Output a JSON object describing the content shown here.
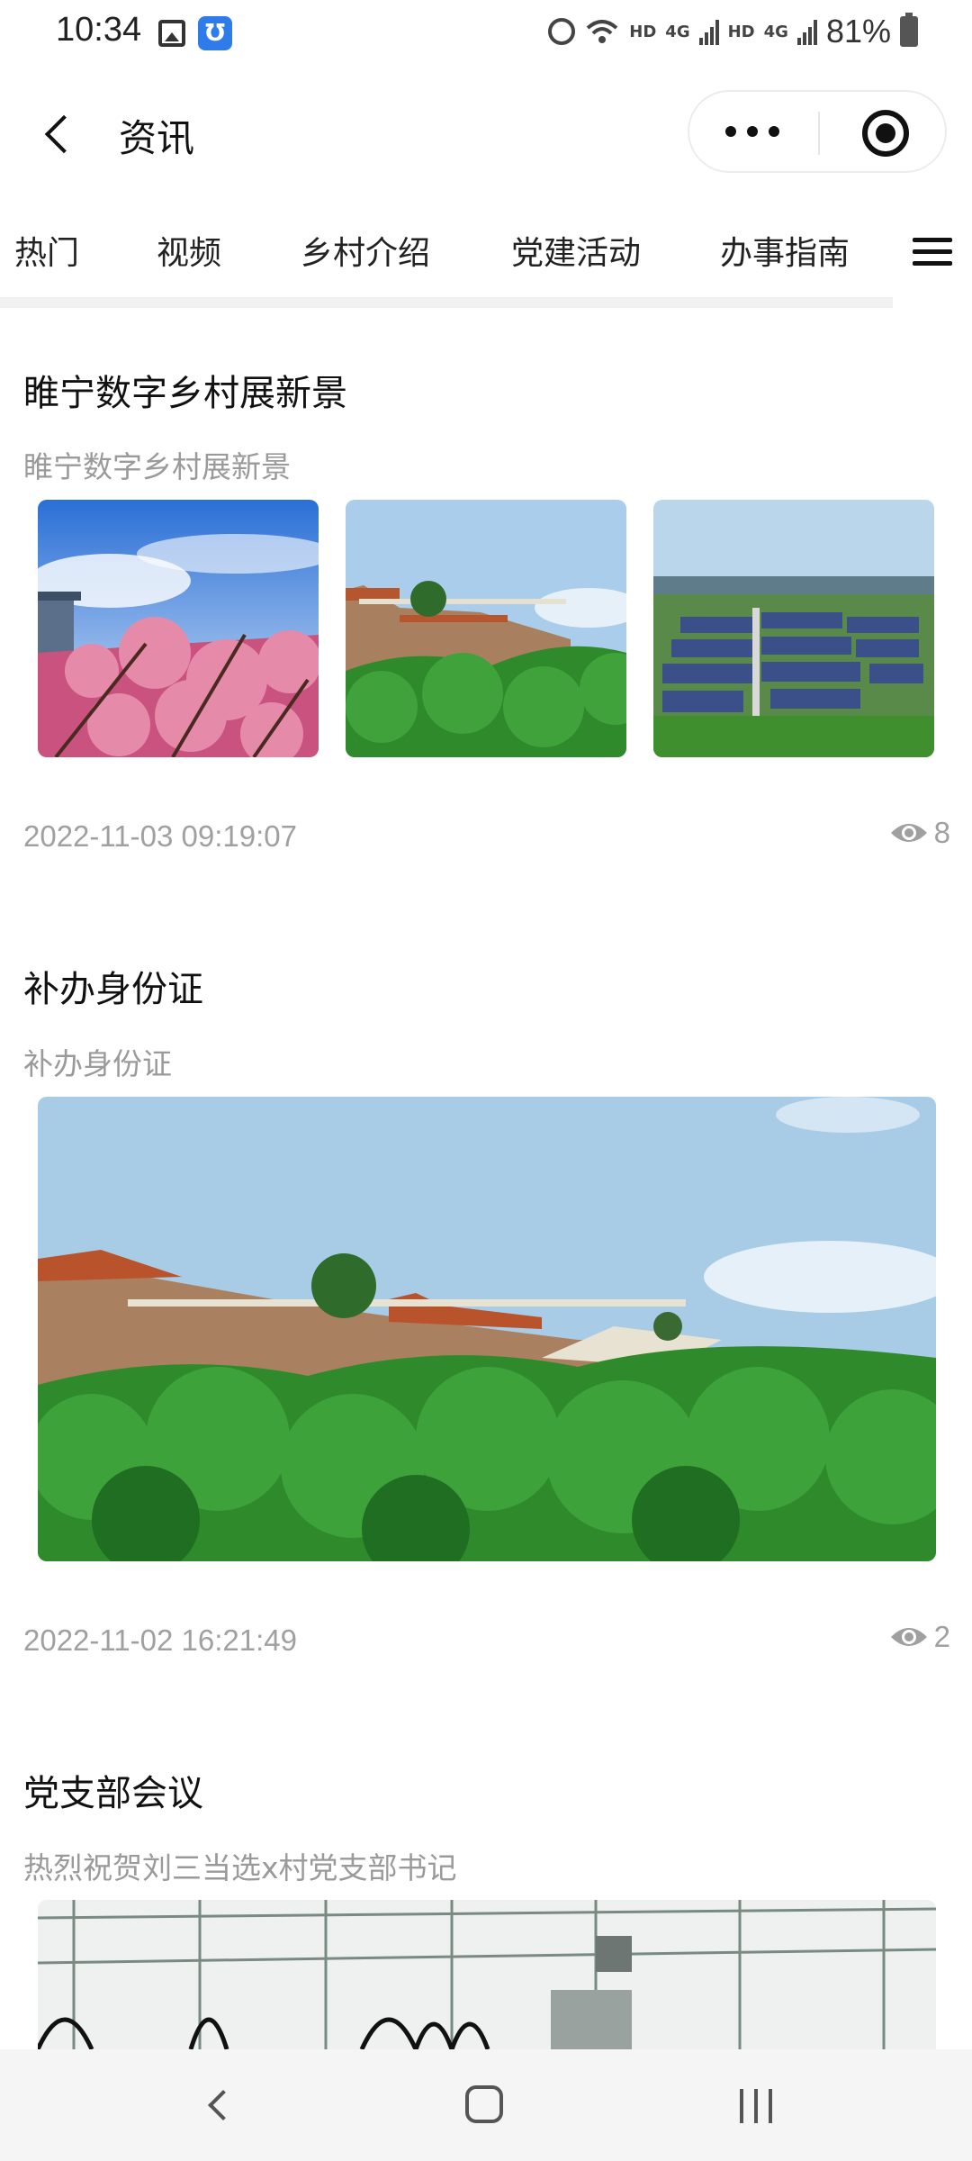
{
  "status_bar": {
    "time": "10:34",
    "app_badge": "Ʊ",
    "hd1": "HD",
    "net1": "4G",
    "hd2": "HD",
    "net2": "4G",
    "battery": "81%"
  },
  "header": {
    "title": "资讯",
    "icons": [
      "back-icon",
      "more-icon",
      "target-icon"
    ]
  },
  "tabs": [
    "热门",
    "视频",
    "乡村介绍",
    "党建活动",
    "办事指南"
  ],
  "articles": [
    {
      "title": "睢宁数字乡村展新景",
      "summary": "睢宁数字乡村展新景",
      "date": "2022-11-03 09:19:07",
      "views": "8",
      "images": [
        "peach-blossom-tower",
        "mountain-temple",
        "aerial-village"
      ]
    },
    {
      "title": "补办身份证",
      "summary": "补办身份证",
      "date": "2022-11-02 16:21:49",
      "views": "2",
      "images": [
        "mountain-temple"
      ]
    },
    {
      "title": "党支部会议",
      "summary": "热烈祝贺刘三当选x村党支部书记",
      "images": [
        "greenhouse-interior"
      ]
    }
  ],
  "colors": {
    "text_primary": "#111111",
    "text_secondary": "#9a9a9a",
    "divider": "#f1f1f1",
    "nav_background": "#f5f5f5"
  }
}
